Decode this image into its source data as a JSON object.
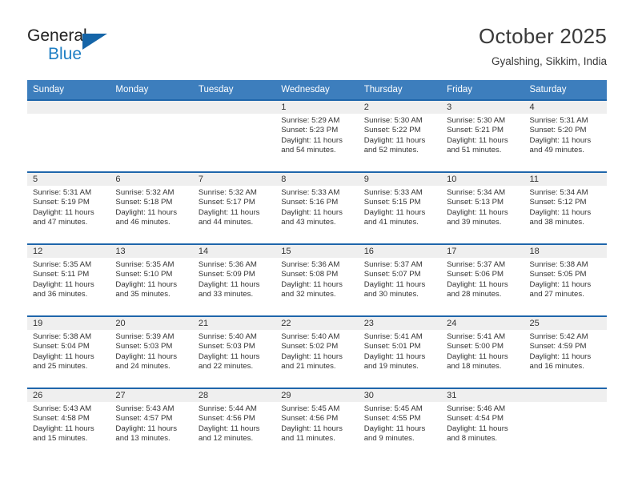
{
  "brand": {
    "name_line1": "General",
    "name_line2": "Blue",
    "logo_icon": "triangle-icon",
    "accent_color": "#1565a8",
    "blue_text_color": "#1f7fc4"
  },
  "header": {
    "title": "October 2025",
    "subtitle": "Gyalshing, Sikkim, India"
  },
  "theme": {
    "header_row_bg": "#3d7ebd",
    "week_separator": "#1f66ab",
    "daynum_strip_bg": "#efefef",
    "text": "#333333"
  },
  "calendar": {
    "weekday_headers": [
      "Sunday",
      "Monday",
      "Tuesday",
      "Wednesday",
      "Thursday",
      "Friday",
      "Saturday"
    ],
    "weeks": [
      [
        {
          "day": "",
          "empty": true
        },
        {
          "day": "",
          "empty": true
        },
        {
          "day": "",
          "empty": true
        },
        {
          "day": "1",
          "sunrise": "Sunrise: 5:29 AM",
          "sunset": "Sunset: 5:23 PM",
          "daylight_line1": "Daylight: 11 hours",
          "daylight_line2": "and 54 minutes."
        },
        {
          "day": "2",
          "sunrise": "Sunrise: 5:30 AM",
          "sunset": "Sunset: 5:22 PM",
          "daylight_line1": "Daylight: 11 hours",
          "daylight_line2": "and 52 minutes."
        },
        {
          "day": "3",
          "sunrise": "Sunrise: 5:30 AM",
          "sunset": "Sunset: 5:21 PM",
          "daylight_line1": "Daylight: 11 hours",
          "daylight_line2": "and 51 minutes."
        },
        {
          "day": "4",
          "sunrise": "Sunrise: 5:31 AM",
          "sunset": "Sunset: 5:20 PM",
          "daylight_line1": "Daylight: 11 hours",
          "daylight_line2": "and 49 minutes."
        }
      ],
      [
        {
          "day": "5",
          "sunrise": "Sunrise: 5:31 AM",
          "sunset": "Sunset: 5:19 PM",
          "daylight_line1": "Daylight: 11 hours",
          "daylight_line2": "and 47 minutes."
        },
        {
          "day": "6",
          "sunrise": "Sunrise: 5:32 AM",
          "sunset": "Sunset: 5:18 PM",
          "daylight_line1": "Daylight: 11 hours",
          "daylight_line2": "and 46 minutes."
        },
        {
          "day": "7",
          "sunrise": "Sunrise: 5:32 AM",
          "sunset": "Sunset: 5:17 PM",
          "daylight_line1": "Daylight: 11 hours",
          "daylight_line2": "and 44 minutes."
        },
        {
          "day": "8",
          "sunrise": "Sunrise: 5:33 AM",
          "sunset": "Sunset: 5:16 PM",
          "daylight_line1": "Daylight: 11 hours",
          "daylight_line2": "and 43 minutes."
        },
        {
          "day": "9",
          "sunrise": "Sunrise: 5:33 AM",
          "sunset": "Sunset: 5:15 PM",
          "daylight_line1": "Daylight: 11 hours",
          "daylight_line2": "and 41 minutes."
        },
        {
          "day": "10",
          "sunrise": "Sunrise: 5:34 AM",
          "sunset": "Sunset: 5:13 PM",
          "daylight_line1": "Daylight: 11 hours",
          "daylight_line2": "and 39 minutes."
        },
        {
          "day": "11",
          "sunrise": "Sunrise: 5:34 AM",
          "sunset": "Sunset: 5:12 PM",
          "daylight_line1": "Daylight: 11 hours",
          "daylight_line2": "and 38 minutes."
        }
      ],
      [
        {
          "day": "12",
          "sunrise": "Sunrise: 5:35 AM",
          "sunset": "Sunset: 5:11 PM",
          "daylight_line1": "Daylight: 11 hours",
          "daylight_line2": "and 36 minutes."
        },
        {
          "day": "13",
          "sunrise": "Sunrise: 5:35 AM",
          "sunset": "Sunset: 5:10 PM",
          "daylight_line1": "Daylight: 11 hours",
          "daylight_line2": "and 35 minutes."
        },
        {
          "day": "14",
          "sunrise": "Sunrise: 5:36 AM",
          "sunset": "Sunset: 5:09 PM",
          "daylight_line1": "Daylight: 11 hours",
          "daylight_line2": "and 33 minutes."
        },
        {
          "day": "15",
          "sunrise": "Sunrise: 5:36 AM",
          "sunset": "Sunset: 5:08 PM",
          "daylight_line1": "Daylight: 11 hours",
          "daylight_line2": "and 32 minutes."
        },
        {
          "day": "16",
          "sunrise": "Sunrise: 5:37 AM",
          "sunset": "Sunset: 5:07 PM",
          "daylight_line1": "Daylight: 11 hours",
          "daylight_line2": "and 30 minutes."
        },
        {
          "day": "17",
          "sunrise": "Sunrise: 5:37 AM",
          "sunset": "Sunset: 5:06 PM",
          "daylight_line1": "Daylight: 11 hours",
          "daylight_line2": "and 28 minutes."
        },
        {
          "day": "18",
          "sunrise": "Sunrise: 5:38 AM",
          "sunset": "Sunset: 5:05 PM",
          "daylight_line1": "Daylight: 11 hours",
          "daylight_line2": "and 27 minutes."
        }
      ],
      [
        {
          "day": "19",
          "sunrise": "Sunrise: 5:38 AM",
          "sunset": "Sunset: 5:04 PM",
          "daylight_line1": "Daylight: 11 hours",
          "daylight_line2": "and 25 minutes."
        },
        {
          "day": "20",
          "sunrise": "Sunrise: 5:39 AM",
          "sunset": "Sunset: 5:03 PM",
          "daylight_line1": "Daylight: 11 hours",
          "daylight_line2": "and 24 minutes."
        },
        {
          "day": "21",
          "sunrise": "Sunrise: 5:40 AM",
          "sunset": "Sunset: 5:03 PM",
          "daylight_line1": "Daylight: 11 hours",
          "daylight_line2": "and 22 minutes."
        },
        {
          "day": "22",
          "sunrise": "Sunrise: 5:40 AM",
          "sunset": "Sunset: 5:02 PM",
          "daylight_line1": "Daylight: 11 hours",
          "daylight_line2": "and 21 minutes."
        },
        {
          "day": "23",
          "sunrise": "Sunrise: 5:41 AM",
          "sunset": "Sunset: 5:01 PM",
          "daylight_line1": "Daylight: 11 hours",
          "daylight_line2": "and 19 minutes."
        },
        {
          "day": "24",
          "sunrise": "Sunrise: 5:41 AM",
          "sunset": "Sunset: 5:00 PM",
          "daylight_line1": "Daylight: 11 hours",
          "daylight_line2": "and 18 minutes."
        },
        {
          "day": "25",
          "sunrise": "Sunrise: 5:42 AM",
          "sunset": "Sunset: 4:59 PM",
          "daylight_line1": "Daylight: 11 hours",
          "daylight_line2": "and 16 minutes."
        }
      ],
      [
        {
          "day": "26",
          "sunrise": "Sunrise: 5:43 AM",
          "sunset": "Sunset: 4:58 PM",
          "daylight_line1": "Daylight: 11 hours",
          "daylight_line2": "and 15 minutes."
        },
        {
          "day": "27",
          "sunrise": "Sunrise: 5:43 AM",
          "sunset": "Sunset: 4:57 PM",
          "daylight_line1": "Daylight: 11 hours",
          "daylight_line2": "and 13 minutes."
        },
        {
          "day": "28",
          "sunrise": "Sunrise: 5:44 AM",
          "sunset": "Sunset: 4:56 PM",
          "daylight_line1": "Daylight: 11 hours",
          "daylight_line2": "and 12 minutes."
        },
        {
          "day": "29",
          "sunrise": "Sunrise: 5:45 AM",
          "sunset": "Sunset: 4:56 PM",
          "daylight_line1": "Daylight: 11 hours",
          "daylight_line2": "and 11 minutes."
        },
        {
          "day": "30",
          "sunrise": "Sunrise: 5:45 AM",
          "sunset": "Sunset: 4:55 PM",
          "daylight_line1": "Daylight: 11 hours",
          "daylight_line2": "and 9 minutes."
        },
        {
          "day": "31",
          "sunrise": "Sunrise: 5:46 AM",
          "sunset": "Sunset: 4:54 PM",
          "daylight_line1": "Daylight: 11 hours",
          "daylight_line2": "and 8 minutes."
        },
        {
          "day": "",
          "empty": true
        }
      ]
    ]
  }
}
